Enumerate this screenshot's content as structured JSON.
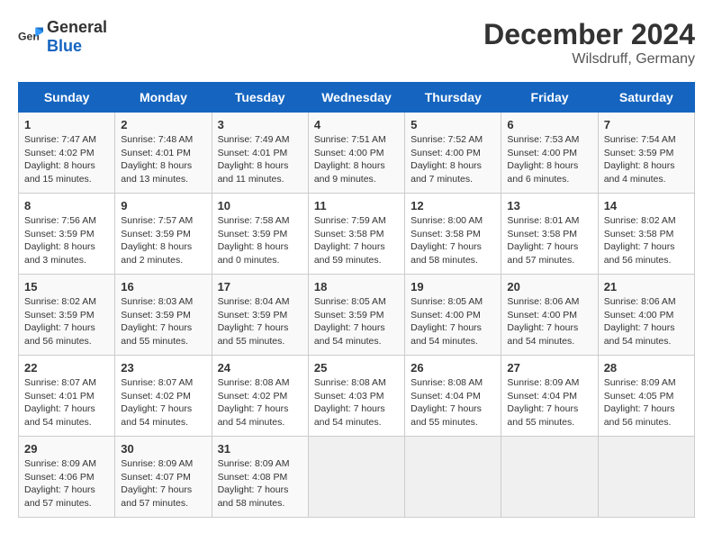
{
  "header": {
    "logo_general": "General",
    "logo_blue": "Blue",
    "title": "December 2024",
    "location": "Wilsdruff, Germany"
  },
  "weekdays": [
    "Sunday",
    "Monday",
    "Tuesday",
    "Wednesday",
    "Thursday",
    "Friday",
    "Saturday"
  ],
  "weeks": [
    [
      {
        "day": "1",
        "info": "Sunrise: 7:47 AM\nSunset: 4:02 PM\nDaylight: 8 hours\nand 15 minutes."
      },
      {
        "day": "2",
        "info": "Sunrise: 7:48 AM\nSunset: 4:01 PM\nDaylight: 8 hours\nand 13 minutes."
      },
      {
        "day": "3",
        "info": "Sunrise: 7:49 AM\nSunset: 4:01 PM\nDaylight: 8 hours\nand 11 minutes."
      },
      {
        "day": "4",
        "info": "Sunrise: 7:51 AM\nSunset: 4:00 PM\nDaylight: 8 hours\nand 9 minutes."
      },
      {
        "day": "5",
        "info": "Sunrise: 7:52 AM\nSunset: 4:00 PM\nDaylight: 8 hours\nand 7 minutes."
      },
      {
        "day": "6",
        "info": "Sunrise: 7:53 AM\nSunset: 4:00 PM\nDaylight: 8 hours\nand 6 minutes."
      },
      {
        "day": "7",
        "info": "Sunrise: 7:54 AM\nSunset: 3:59 PM\nDaylight: 8 hours\nand 4 minutes."
      }
    ],
    [
      {
        "day": "8",
        "info": "Sunrise: 7:56 AM\nSunset: 3:59 PM\nDaylight: 8 hours\nand 3 minutes."
      },
      {
        "day": "9",
        "info": "Sunrise: 7:57 AM\nSunset: 3:59 PM\nDaylight: 8 hours\nand 2 minutes."
      },
      {
        "day": "10",
        "info": "Sunrise: 7:58 AM\nSunset: 3:59 PM\nDaylight: 8 hours\nand 0 minutes."
      },
      {
        "day": "11",
        "info": "Sunrise: 7:59 AM\nSunset: 3:58 PM\nDaylight: 7 hours\nand 59 minutes."
      },
      {
        "day": "12",
        "info": "Sunrise: 8:00 AM\nSunset: 3:58 PM\nDaylight: 7 hours\nand 58 minutes."
      },
      {
        "day": "13",
        "info": "Sunrise: 8:01 AM\nSunset: 3:58 PM\nDaylight: 7 hours\nand 57 minutes."
      },
      {
        "day": "14",
        "info": "Sunrise: 8:02 AM\nSunset: 3:58 PM\nDaylight: 7 hours\nand 56 minutes."
      }
    ],
    [
      {
        "day": "15",
        "info": "Sunrise: 8:02 AM\nSunset: 3:59 PM\nDaylight: 7 hours\nand 56 minutes."
      },
      {
        "day": "16",
        "info": "Sunrise: 8:03 AM\nSunset: 3:59 PM\nDaylight: 7 hours\nand 55 minutes."
      },
      {
        "day": "17",
        "info": "Sunrise: 8:04 AM\nSunset: 3:59 PM\nDaylight: 7 hours\nand 55 minutes."
      },
      {
        "day": "18",
        "info": "Sunrise: 8:05 AM\nSunset: 3:59 PM\nDaylight: 7 hours\nand 54 minutes."
      },
      {
        "day": "19",
        "info": "Sunrise: 8:05 AM\nSunset: 4:00 PM\nDaylight: 7 hours\nand 54 minutes."
      },
      {
        "day": "20",
        "info": "Sunrise: 8:06 AM\nSunset: 4:00 PM\nDaylight: 7 hours\nand 54 minutes."
      },
      {
        "day": "21",
        "info": "Sunrise: 8:06 AM\nSunset: 4:00 PM\nDaylight: 7 hours\nand 54 minutes."
      }
    ],
    [
      {
        "day": "22",
        "info": "Sunrise: 8:07 AM\nSunset: 4:01 PM\nDaylight: 7 hours\nand 54 minutes."
      },
      {
        "day": "23",
        "info": "Sunrise: 8:07 AM\nSunset: 4:02 PM\nDaylight: 7 hours\nand 54 minutes."
      },
      {
        "day": "24",
        "info": "Sunrise: 8:08 AM\nSunset: 4:02 PM\nDaylight: 7 hours\nand 54 minutes."
      },
      {
        "day": "25",
        "info": "Sunrise: 8:08 AM\nSunset: 4:03 PM\nDaylight: 7 hours\nand 54 minutes."
      },
      {
        "day": "26",
        "info": "Sunrise: 8:08 AM\nSunset: 4:04 PM\nDaylight: 7 hours\nand 55 minutes."
      },
      {
        "day": "27",
        "info": "Sunrise: 8:09 AM\nSunset: 4:04 PM\nDaylight: 7 hours\nand 55 minutes."
      },
      {
        "day": "28",
        "info": "Sunrise: 8:09 AM\nSunset: 4:05 PM\nDaylight: 7 hours\nand 56 minutes."
      }
    ],
    [
      {
        "day": "29",
        "info": "Sunrise: 8:09 AM\nSunset: 4:06 PM\nDaylight: 7 hours\nand 57 minutes."
      },
      {
        "day": "30",
        "info": "Sunrise: 8:09 AM\nSunset: 4:07 PM\nDaylight: 7 hours\nand 57 minutes."
      },
      {
        "day": "31",
        "info": "Sunrise: 8:09 AM\nSunset: 4:08 PM\nDaylight: 7 hours\nand 58 minutes."
      },
      null,
      null,
      null,
      null
    ]
  ]
}
